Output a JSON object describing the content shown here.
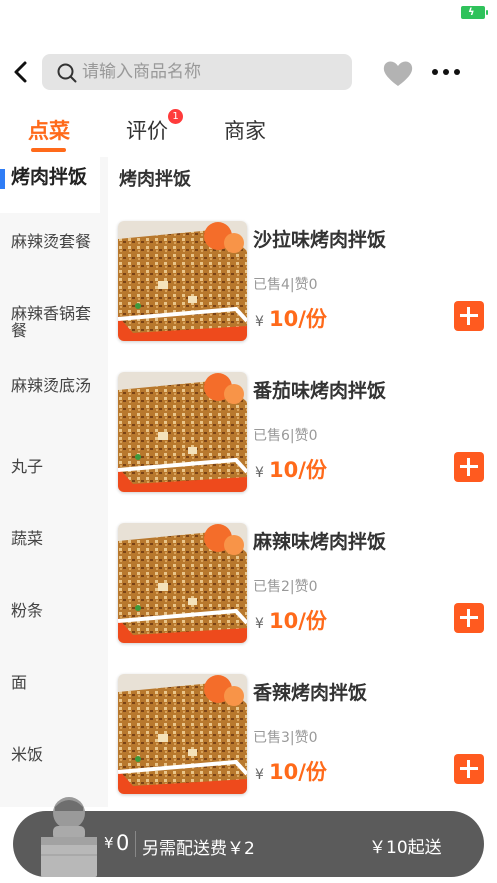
{
  "search": {
    "placeholder": "请输入商品名称"
  },
  "tabs": [
    {
      "label": "点菜"
    },
    {
      "label": "评价",
      "badge": "1"
    },
    {
      "label": "商家"
    }
  ],
  "sidebar": {
    "items": [
      {
        "label": "烤肉拌饭"
      },
      {
        "label": "麻辣烫套餐"
      },
      {
        "label": "麻辣香锅套餐"
      },
      {
        "label": "麻辣烫底汤"
      },
      {
        "label": "丸子"
      },
      {
        "label": "蔬菜"
      },
      {
        "label": "粉条"
      },
      {
        "label": "面"
      },
      {
        "label": "米饭"
      }
    ]
  },
  "main": {
    "section_title": "烤肉拌饭",
    "products": [
      {
        "name": "沙拉味烤肉拌饭",
        "sales": "已售4|赞0",
        "currency": "¥",
        "price": "10/份"
      },
      {
        "name": "番茄味烤肉拌饭",
        "sales": "已售6|赞0",
        "currency": "¥",
        "price": "10/份"
      },
      {
        "name": "麻辣味烤肉拌饭",
        "sales": "已售2|赞0",
        "currency": "¥",
        "price": "10/份"
      },
      {
        "name": "香辣烤肉拌饭",
        "sales": "已售3|赞0",
        "currency": "¥",
        "price": "10/份"
      }
    ]
  },
  "cart": {
    "currency": "¥",
    "total": "0",
    "delivery_fee": "另需配送费￥2",
    "min_order": "￥10起送"
  },
  "colors": {
    "accent": "#ff6a1a",
    "add_button": "#ff5a1f",
    "sidebar_marker": "#2f7df6",
    "cart_bar": "#5b5b5b",
    "badge": "#ff3b3b"
  },
  "icons": [
    "battery-icon",
    "back-icon",
    "search-icon",
    "heart-icon",
    "more-icon",
    "plus-icon",
    "cart-avatar-icon"
  ]
}
